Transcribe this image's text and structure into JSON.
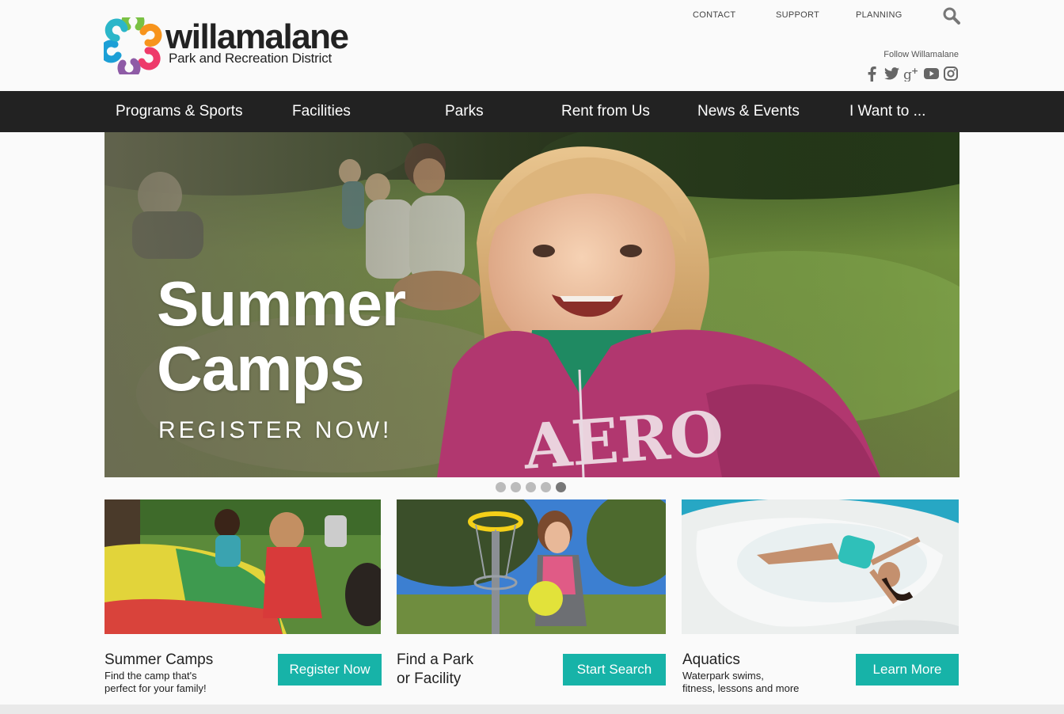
{
  "header": {
    "logo_name": "willamalane",
    "logo_sub": "Park and Recreation District",
    "util_links": [
      "CONTACT",
      "SUPPORT",
      "PLANNING"
    ],
    "follow_label": "Follow Willamalane"
  },
  "nav": {
    "items": [
      "Programs & Sports",
      "Facilities",
      "Parks",
      "Rent from Us",
      "News & Events",
      "I Want to ..."
    ]
  },
  "hero": {
    "title_line1": "Summer",
    "title_line2": "Camps",
    "subtitle": "REGISTER NOW!",
    "slide_count": 5,
    "active_slide": 5
  },
  "cards": [
    {
      "title": "Summer Camps",
      "desc_line1": "Find the camp that's",
      "desc_line2": "perfect for your family!",
      "button": "Register Now"
    },
    {
      "title_line1": "Find a Park",
      "title_line2": "or Facility",
      "button": "Start Search"
    },
    {
      "title": "Aquatics",
      "desc_line1": "Waterpark swims,",
      "desc_line2": "fitness, lessons and more",
      "button": "Learn More"
    }
  ],
  "colors": {
    "accent": "#17b3a8",
    "nav_bg": "#222222",
    "logo_petals": [
      "#2bb6c9",
      "#7ac143",
      "#f7941d",
      "#ee3a6a",
      "#8e5ba6",
      "#1c9fd6"
    ]
  },
  "icons": {
    "search": "search-icon",
    "social": [
      "facebook-icon",
      "twitter-icon",
      "google-plus-icon",
      "youtube-icon",
      "instagram-icon"
    ]
  }
}
